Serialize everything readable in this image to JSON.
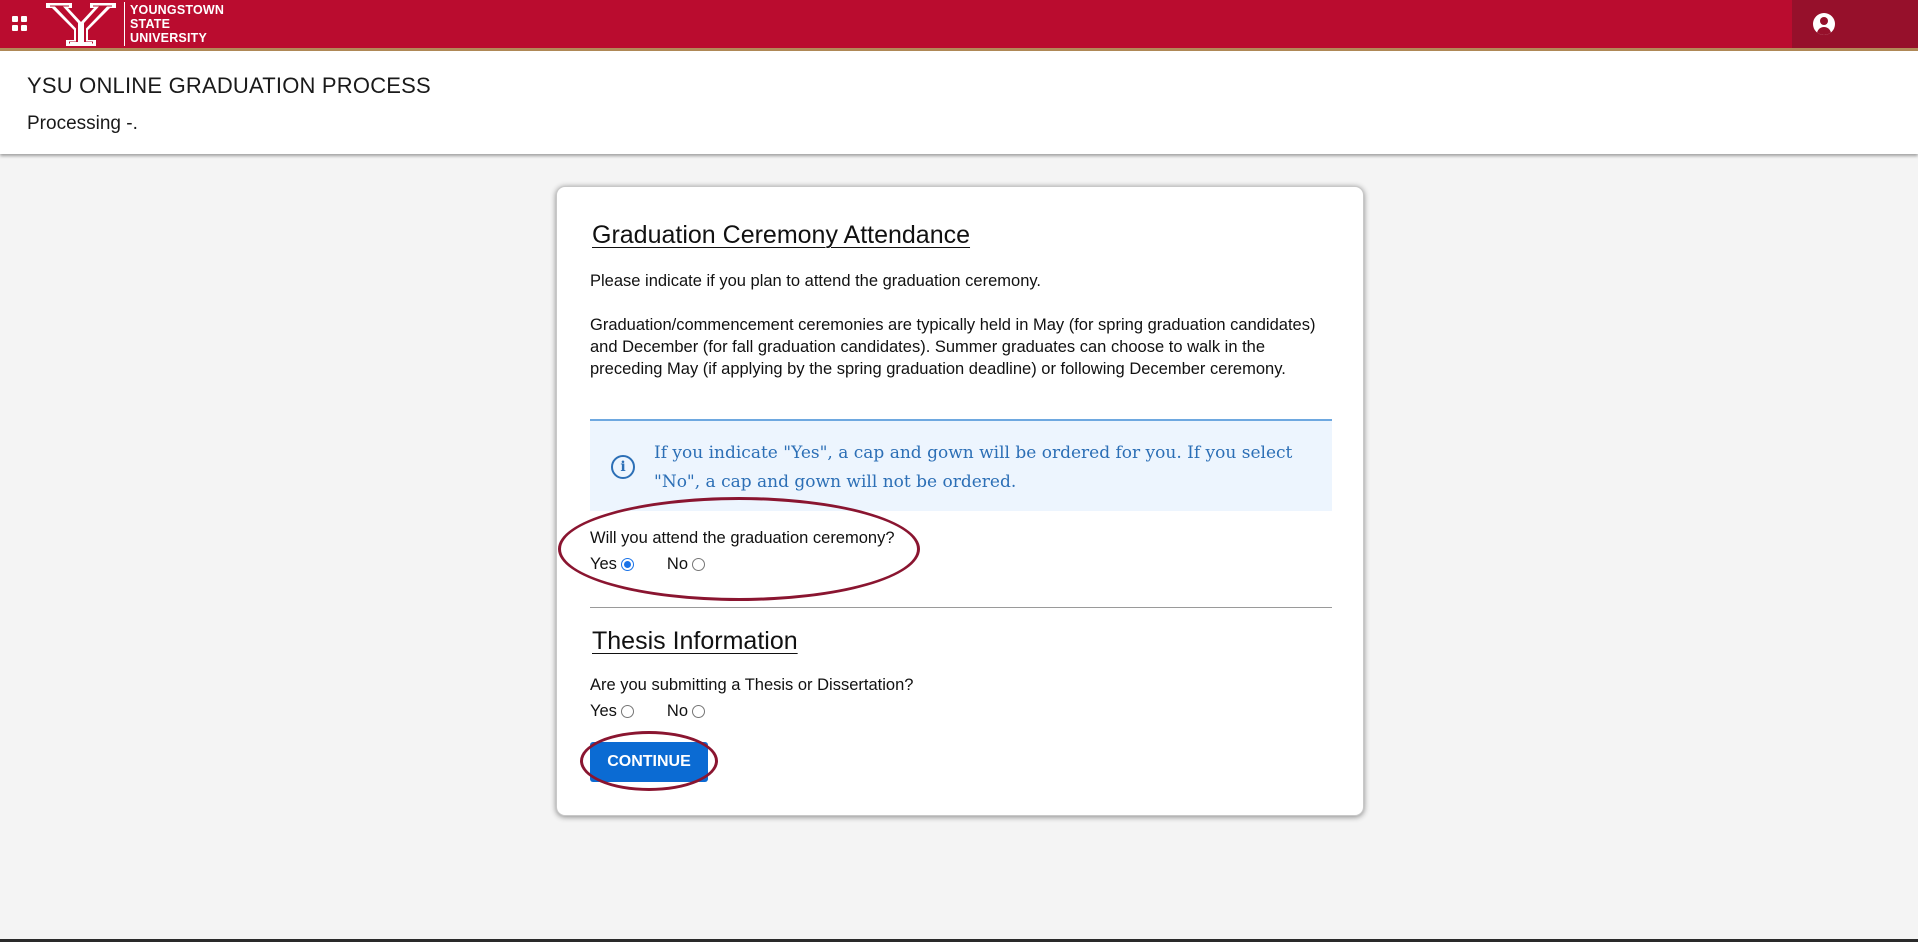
{
  "header": {
    "university_line1": "YOUNGSTOWN",
    "university_line2": "STATE",
    "university_line3": "UNIVERSITY",
    "apps_icon": "apps-grid-icon",
    "user_icon": "user-profile-icon"
  },
  "page": {
    "title": "YSU ONLINE GRADUATION PROCESS",
    "subtitle": "Processing -."
  },
  "ceremony": {
    "title": "Graduation Ceremony Attendance",
    "intro": "Please indicate if you plan to attend the graduation ceremony.",
    "details": "Graduation/commencement ceremonies are typically held in May (for spring graduation candidates) and December (for fall graduation candidates). Summer graduates can choose to walk in the preceding May (if applying by the spring graduation deadline) or following December ceremony.",
    "info_icon": "info-circle-icon",
    "info_text": "If you indicate \"Yes\", a cap and gown will be ordered for you. If you select \"No\", a cap and gown will not be ordered.",
    "question": "Will you attend the graduation ceremony?",
    "yes_label": "Yes",
    "no_label": "No",
    "selected": "Yes"
  },
  "thesis": {
    "title": "Thesis Information",
    "question": "Are you submitting a Thesis or Dissertation?",
    "yes_label": "Yes",
    "no_label": "No",
    "selected": null
  },
  "actions": {
    "continue_label": "CONTINUE"
  },
  "colors": {
    "brand_red": "#ba0c2f",
    "brand_dark_red": "#96102b",
    "accent_gold": "#b38b59",
    "primary_blue": "#0b6bd3",
    "info_blue": "#2c6fb6",
    "highlight": "#8a1530"
  }
}
